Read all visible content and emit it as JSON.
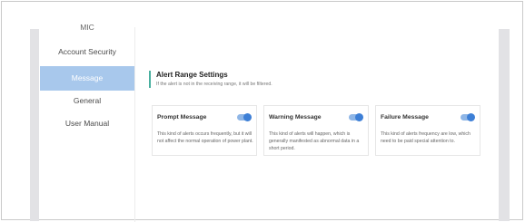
{
  "sidebar": {
    "items": [
      {
        "label": "MIC"
      },
      {
        "label": "Account Security"
      },
      {
        "label": "Message",
        "active": true
      },
      {
        "label": "General"
      },
      {
        "label": "User Manual"
      }
    ]
  },
  "section": {
    "title": "Alert Range Settings",
    "subtitle": "If the alert is not in the receiving range, it will be filtered."
  },
  "cards": [
    {
      "title": "Prompt Message",
      "enabled": true,
      "description": "This kind of alerts occurs frequently, but it will not affect the normal operation of power plant."
    },
    {
      "title": "Warning Message",
      "enabled": true,
      "description": "This kind of alerts will happen, which is generally manifested as abnormal data in a short period."
    },
    {
      "title": "Failure Message",
      "enabled": true,
      "description": "This kind of alerts frequency are low, which need to be paid special attention to."
    }
  ],
  "colors": {
    "accent": "#3d7fd6",
    "toggle_track": "#8fb6e6",
    "active_nav": "#a8c8ec",
    "section_marker": "#4ab0a0"
  }
}
